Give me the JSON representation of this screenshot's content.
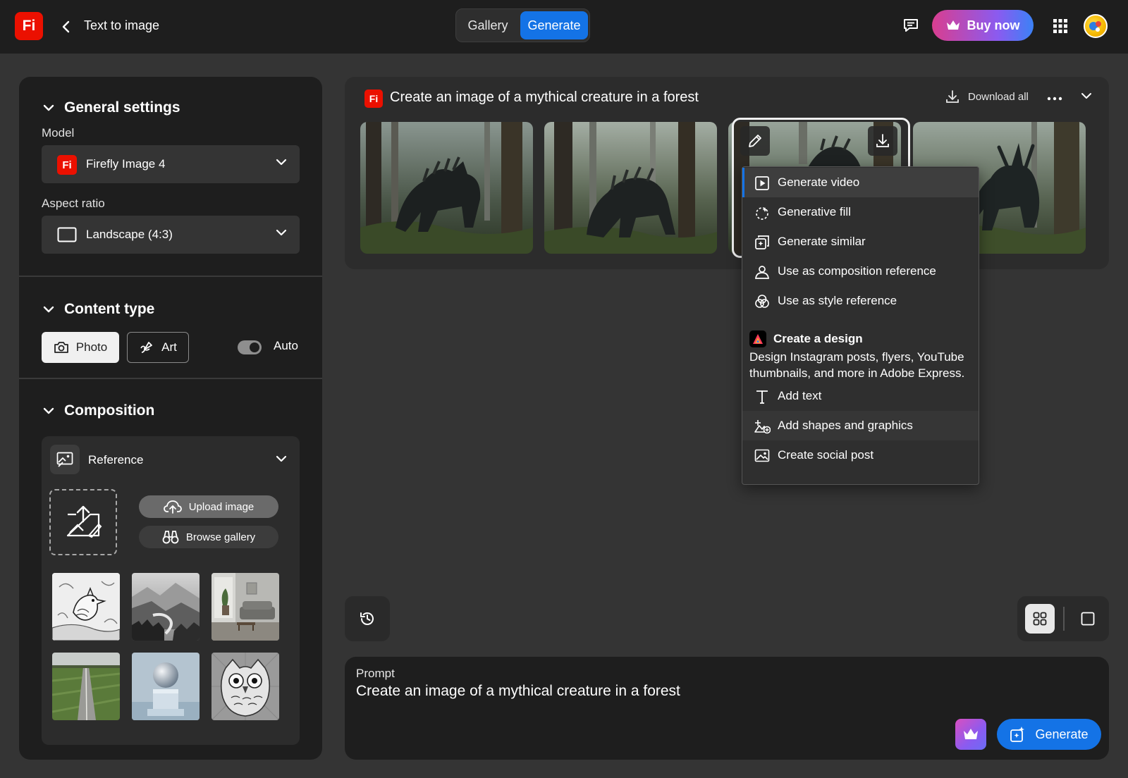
{
  "header": {
    "logo_text": "Fi",
    "title": "Text to image",
    "tabs": [
      {
        "label": "Gallery",
        "active": false
      },
      {
        "label": "Generate",
        "active": true
      }
    ],
    "buy_label": "Buy now",
    "accent_color": "#1473e6",
    "brand_color": "#eb1000"
  },
  "left_panel": {
    "general_settings": {
      "heading": "General settings",
      "model_label": "Model",
      "model_value": "Firefly Image 4",
      "model_badge": "Fi",
      "aspect_label": "Aspect ratio",
      "aspect_value": "Landscape (4:3)"
    },
    "content_type": {
      "heading": "Content type",
      "photo_label": "Photo",
      "art_label": "Art",
      "auto_label": "Auto",
      "selected": "Photo",
      "auto_on": true
    },
    "composition": {
      "heading": "Composition",
      "reference_label": "Reference",
      "upload_label": "Upload image",
      "browse_label": "Browse gallery",
      "thumbnails": [
        {
          "name": "bird-sketch-thumbnail"
        },
        {
          "name": "misty-valley-thumbnail"
        },
        {
          "name": "living-room-thumbnail"
        },
        {
          "name": "road-field-thumbnail"
        },
        {
          "name": "sphere-cube-thumbnail"
        },
        {
          "name": "owl-sketch-thumbnail"
        }
      ]
    }
  },
  "results": {
    "badge": "Fi",
    "title": "Create an image of a mythical creature in a forest",
    "download_all_label": "Download all",
    "images": [
      {
        "name": "generated-image-1"
      },
      {
        "name": "generated-image-2"
      },
      {
        "name": "generated-image-3",
        "selected": true
      },
      {
        "name": "generated-image-4"
      }
    ]
  },
  "context_menu": {
    "items_top": [
      {
        "icon": "play-icon",
        "label": "Generate video",
        "active": true
      },
      {
        "icon": "generative-fill-icon",
        "label": "Generative fill"
      },
      {
        "icon": "generate-similar-icon",
        "label": "Generate similar"
      },
      {
        "icon": "person-icon",
        "label": "Use as composition reference"
      },
      {
        "icon": "style-circles-icon",
        "label": "Use as style reference"
      }
    ],
    "design": {
      "title": "Create a design",
      "description": "Design Instagram posts, flyers, YouTube thumbnails, and more in Adobe Express."
    },
    "items_bottom": [
      {
        "icon": "text-icon",
        "label": "Add text"
      },
      {
        "icon": "shapes-icon",
        "label": "Add shapes and graphics",
        "hover": true
      },
      {
        "icon": "image-icon",
        "label": "Create social post"
      }
    ]
  },
  "prompt": {
    "label": "Prompt",
    "text": "Create an image of a mythical creature in a forest",
    "generate_label": "Generate"
  }
}
